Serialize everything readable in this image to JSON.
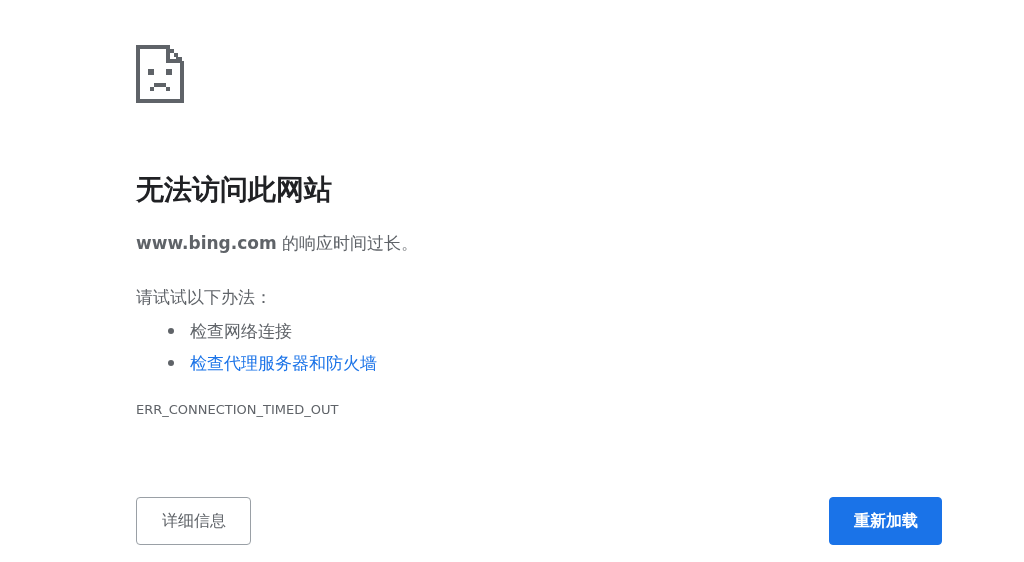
{
  "error_page": {
    "title": "无法访问此网站",
    "message": "**www.bing.com** 的响应时间过长。",
    "suggestions_heading": "请试试以下办法：",
    "suggestions": [
      {
        "kind": "text",
        "label": "检查网络连接"
      },
      {
        "kind": "link",
        "label": "检查代理服务器和防火墙"
      }
    ],
    "error_code": "ERR_CONNECTION_TIMED_OUT",
    "buttons": [
      {
        "kind": "secondary",
        "label": "详细信息"
      },
      {
        "kind": "primary",
        "label": "重新加载"
      }
    ]
  }
}
